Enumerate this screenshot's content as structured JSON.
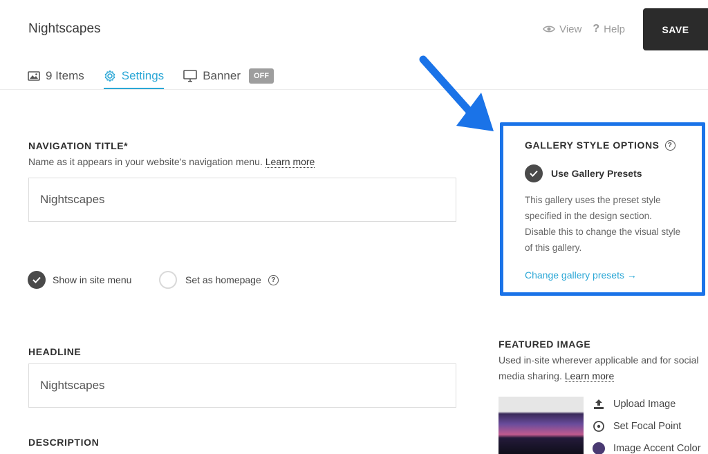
{
  "header": {
    "title": "Nightscapes",
    "view_label": "View",
    "help_label": "Help",
    "save_label": "SAVE"
  },
  "tabs": [
    {
      "label": "9 Items"
    },
    {
      "label": "Settings"
    },
    {
      "label": "Banner",
      "badge": "OFF"
    }
  ],
  "navigation": {
    "label": "NAVIGATION TITLE*",
    "hint": "Name as it appears in your website's navigation menu.",
    "learn_more": "Learn more",
    "value": "Nightscapes"
  },
  "options": {
    "show_in_menu": "Show in site menu",
    "show_in_menu_checked": true,
    "set_homepage": "Set as homepage",
    "set_homepage_checked": false
  },
  "headline": {
    "label": "HEADLINE",
    "value": "Nightscapes"
  },
  "description": {
    "label": "DESCRIPTION"
  },
  "gallery_style": {
    "title": "GALLERY STYLE OPTIONS",
    "use_presets": "Use Gallery Presets",
    "use_presets_checked": true,
    "description": "This gallery uses the preset style specified in the design section. Disable this to change the visual style of this gallery.",
    "link": "Change gallery presets →",
    "highlight_color": "#1a73e8"
  },
  "featured_image": {
    "label": "FEATURED IMAGE",
    "hint": "Used in-site wherever applicable and for social media sharing.",
    "learn_more": "Learn more",
    "actions": {
      "upload": "Upload Image",
      "focal": "Set Focal Point",
      "accent": "Image Accent Color"
    },
    "accent_color": "#4a3a72"
  },
  "colors": {
    "accent": "#2ba7d6",
    "save_bg": "#2b2b2b",
    "arrow": "#1a73e8"
  }
}
